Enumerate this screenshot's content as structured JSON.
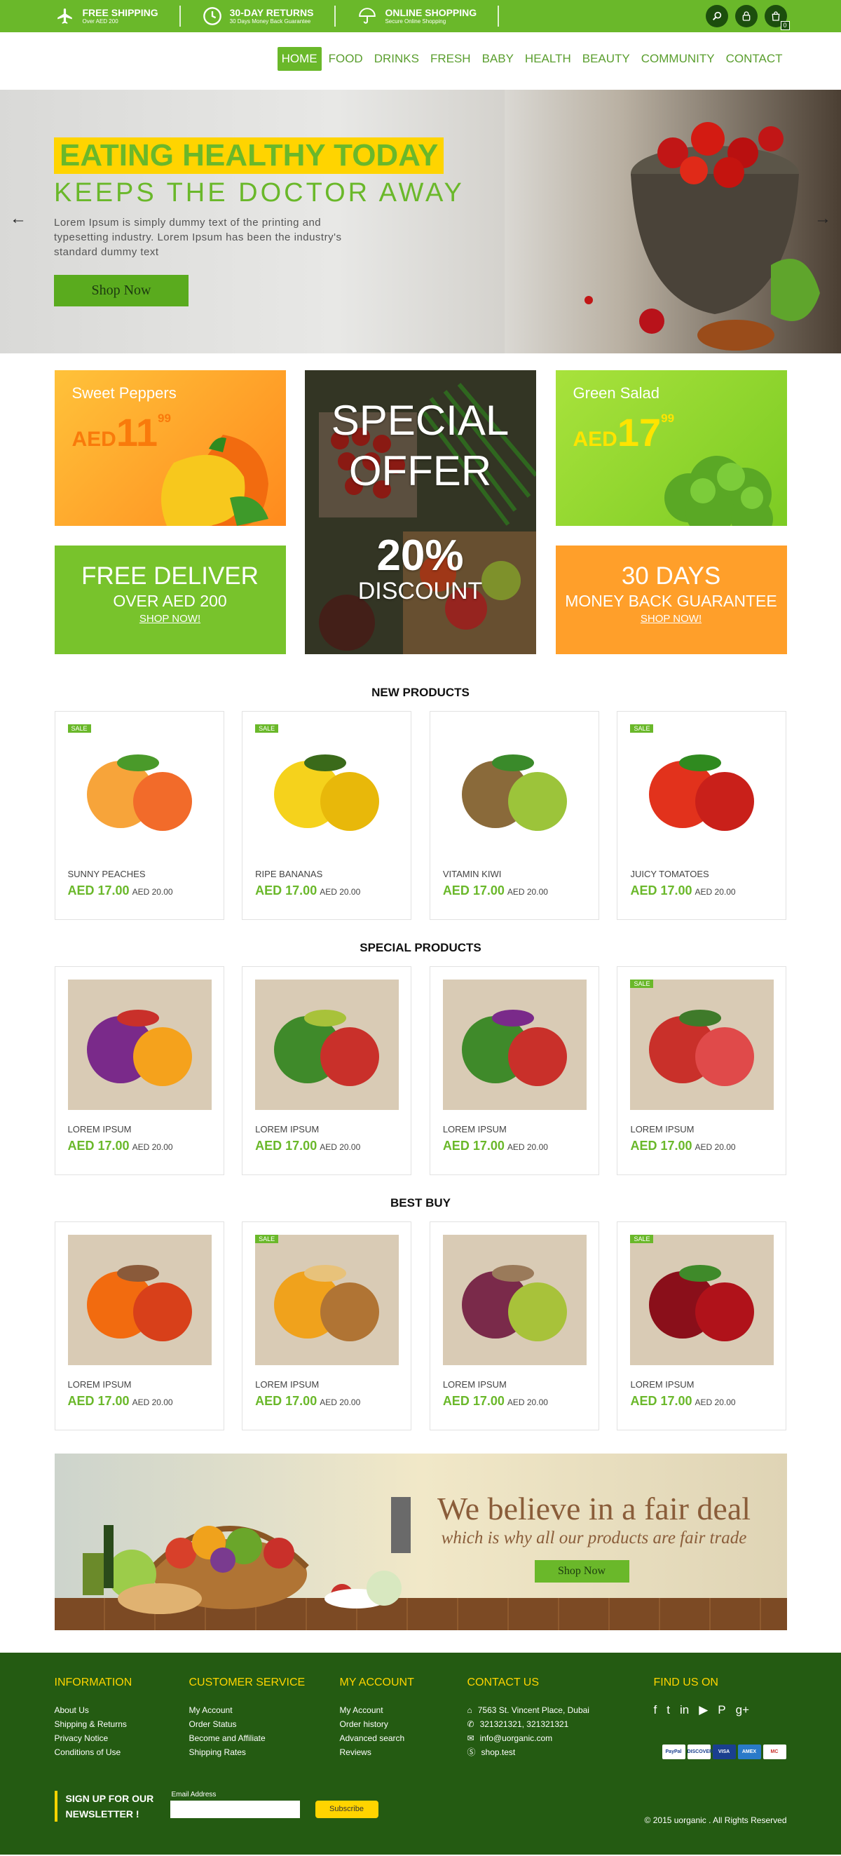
{
  "topbar": {
    "items": [
      {
        "title": "FREE SHIPPING",
        "sub": "Over AED 200",
        "icon": "plane-icon"
      },
      {
        "title": "30-DAY RETURNS",
        "sub": "30 Days Money Back Guarantee",
        "icon": "clock-icon"
      },
      {
        "title": "ONLINE SHOPPING",
        "sub": "Secure Online Shopping",
        "icon": "umbrella-icon"
      }
    ],
    "cart_count": "0"
  },
  "nav": [
    "HOME",
    "FOOD",
    "DRINKS",
    "FRESH",
    "BABY",
    "HEALTH",
    "BEAUTY",
    "COMMUNITY",
    "CONTACT"
  ],
  "hero": {
    "title": "EATING HEALTHY TODAY",
    "subtitle": "KEEPS THE DOCTOR AWAY",
    "text": "Lorem Ipsum is simply dummy text of the printing and typesetting industry. Lorem Ipsum has been the industry's standard dummy text",
    "button": "Shop Now"
  },
  "promos": {
    "peppers": {
      "name": "Sweet Peppers",
      "currency": "AED",
      "int": "11",
      "dec": "99"
    },
    "salad": {
      "name": "Green Salad",
      "currency": "AED",
      "int": "17",
      "dec": "99"
    },
    "special": {
      "line1": "SPECIAL",
      "line2": "OFFER",
      "pct": "20%",
      "disc": "DISCOUNT"
    },
    "deliver": {
      "title": "FREE DELIVER",
      "sub": "OVER AED 200",
      "link": "SHOP NOW!"
    },
    "days": {
      "title": "30 DAYS",
      "sub": "MONEY BACK GUARANTEE",
      "link": "SHOP NOW!"
    }
  },
  "sections": [
    {
      "title": "NEW PRODUCTS",
      "products": [
        {
          "name": "SUNNY PEACHES",
          "price": "AED 17.00",
          "old": "AED 20.00",
          "sale": "SALE"
        },
        {
          "name": "RIPE BANANAS",
          "price": "AED 17.00",
          "old": "AED 20.00",
          "sale": "SALE"
        },
        {
          "name": "VITAMIN KIWI",
          "price": "AED 17.00",
          "old": "AED 20.00",
          "sale": ""
        },
        {
          "name": "JUICY TOMATOES",
          "price": "AED 17.00",
          "old": "AED 20.00",
          "sale": "SALE"
        }
      ]
    },
    {
      "title": "SPECIAL PRODUCTS",
      "products": [
        {
          "name": "LOREM IPSUM",
          "price": "AED 17.00",
          "old": "AED 20.00",
          "sale": ""
        },
        {
          "name": "LOREM IPSUM",
          "price": "AED 17.00",
          "old": "AED 20.00",
          "sale": ""
        },
        {
          "name": "LOREM IPSUM",
          "price": "AED 17.00",
          "old": "AED 20.00",
          "sale": ""
        },
        {
          "name": "LOREM IPSUM",
          "price": "AED 17.00",
          "old": "AED 20.00",
          "sale": "SALE"
        }
      ]
    },
    {
      "title": "BEST BUY",
      "products": [
        {
          "name": "LOREM IPSUM",
          "price": "AED 17.00",
          "old": "AED 20.00",
          "sale": ""
        },
        {
          "name": "LOREM IPSUM",
          "price": "AED 17.00",
          "old": "AED 20.00",
          "sale": "SALE"
        },
        {
          "name": "LOREM IPSUM",
          "price": "AED 17.00",
          "old": "AED 20.00",
          "sale": ""
        },
        {
          "name": "LOREM IPSUM",
          "price": "AED 17.00",
          "old": "AED 20.00",
          "sale": "SALE"
        }
      ]
    }
  ],
  "banner": {
    "title": "We believe in a fair deal",
    "subtitle": "which is why all our products are fair trade",
    "button": "Shop Now"
  },
  "footer": {
    "info": {
      "title": "INFORMATION",
      "links": [
        "About Us",
        "Shipping & Returns",
        "Privacy Notice",
        "Conditions of Use"
      ]
    },
    "service": {
      "title": "CUSTOMER SERVICE",
      "links": [
        "My Account",
        "Order Status",
        "Become and Affiliate",
        "Shipping Rates"
      ]
    },
    "account": {
      "title": "MY ACCOUNT",
      "links": [
        "My Account",
        "Order history",
        "Advanced search",
        "Reviews"
      ]
    },
    "contact": {
      "title": "CONTACT US",
      "address": "7563 St. Vincent Place, Dubai",
      "phone": "321321321, 321321321",
      "email": "info@uorganic.com",
      "web": "shop.test"
    },
    "find": {
      "title": "FIND US ON"
    },
    "payments": [
      "PayPal",
      "DISCOVER",
      "VISA",
      "AMEX",
      "MC"
    ],
    "newsletter": "SIGN UP FOR OUR NEWSLETTER !",
    "email_label": "Email Address",
    "subscribe": "Subscribe",
    "copyright": "© 2015 uorganic . All Rights Reserved"
  },
  "colors": {
    "brand_green": "#6ab82a",
    "dark_green": "#245b12",
    "yellow": "#ffd400",
    "orange": "#ff9f2a"
  }
}
